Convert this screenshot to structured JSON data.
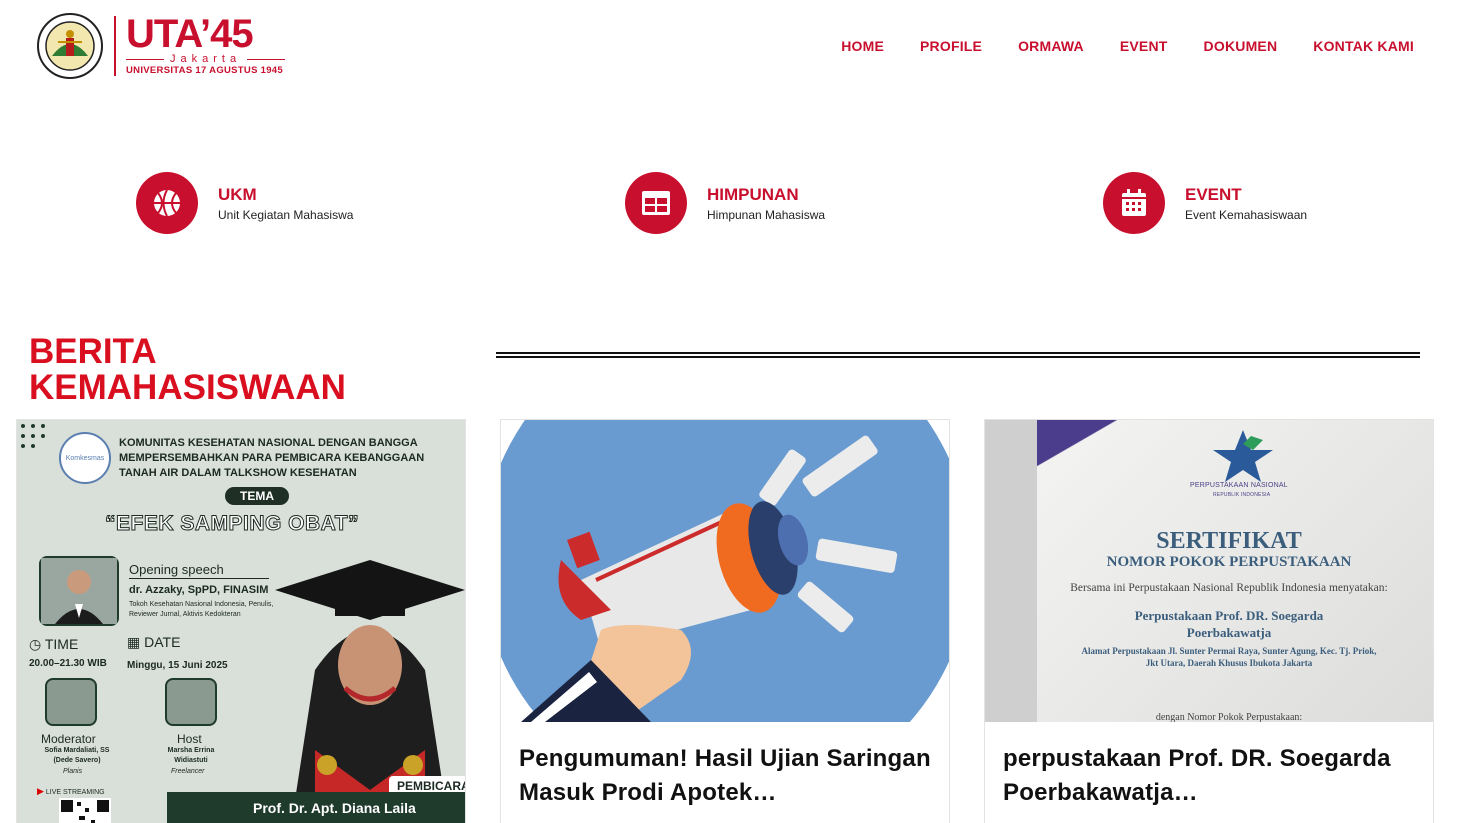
{
  "brand": {
    "main": "UTA’45",
    "city": "Jakarta",
    "university": "UNIVERSITAS 17 AGUSTUS 1945",
    "seal_ring_text": "UNIVERSITAS 17 AGUSTUS 1945 JAKARTA",
    "color": "#c8102e"
  },
  "nav": {
    "items": [
      "HOME",
      "PROFILE",
      "ORMAWA",
      "EVENT",
      "DOKUMEN",
      "KONTAK KAMI"
    ]
  },
  "features": [
    {
      "title": "UKM",
      "subtitle": "Unit Kegiatan Mahasiswa",
      "icon": "basketball-icon"
    },
    {
      "title": "HIMPUNAN",
      "subtitle": "Himpunan Mahasiswa",
      "icon": "table-grid-icon"
    },
    {
      "title": "EVENT",
      "subtitle": "Event Kemahasiswaan",
      "icon": "calendar-icon"
    }
  ],
  "section": {
    "title_line1": "BERITA",
    "title_line2": "KEMAHASISWAAN"
  },
  "cards": [
    {
      "title": "",
      "poster": {
        "org_logo": "Komkesmas",
        "headline": "KOMUNITAS KESEHATAN NASIONAL DENGAN BANGGA MEMPERSEMBAHKAN PARA PEMBICARA KEBANGGAAN TANAH AIR DALAM TALKSHOW KESEHATAN",
        "tema_label": "TEMA",
        "theme": "“EFEK SAMPING OBAT”",
        "opening_label": "Opening speech",
        "opening_name": "dr. Azzaky, SpPD, FINASIM",
        "opening_desc": "Tokoh Kesehatan Nasional Indonesia, Penulis, Reviewer Jurnal, Aktivis Kedokteran",
        "time_label": "TIME",
        "time_value": "20.00–21.30 WIB",
        "date_label": "DATE",
        "date_value": "Minggu, 15 Juni 2025",
        "moderator_label": "Moderator",
        "moderator_name": "Sofia Mardaliati, SS (Dede Savero)",
        "moderator_role": "Planis",
        "host_label": "Host",
        "host_name": "Marsha Errina Widiastuti",
        "host_role": "Freelancer",
        "live_label": "LIVE STREAMING",
        "speaker_tag": "PEMBICARA",
        "speaker_name": "Prof. Dr. Apt. Diana Laila"
      }
    },
    {
      "title": "Pengumuman! Hasil Ujian Saringan Masuk Prodi Apotek…",
      "image": "megaphone-illustration"
    },
    {
      "title": "perpustakaan Prof. DR. Soegarda Poerbakawatja…",
      "cert": {
        "library": "PERPUSTAKAAN NASIONAL",
        "library_sub": "REPUBLIK INDONESIA",
        "heading": "SERTIFIKAT",
        "subheading": "NOMOR POKOK PERPUSTAKAAN",
        "line1": "Bersama ini Perpustakaan Nasional Republik Indonesia menyatakan:",
        "name_line1": "Perpustakaan Prof. DR. Soegarda",
        "name_line2": "Poerbakawatja",
        "address1": "Alamat Perpustakaan  Jl. Sunter Permai Raya, Sunter Agung, Kec. Tj. Priok,",
        "address2": "Jkt Utara, Daerah Khusus Ibukota Jakarta",
        "footer": "dengan Nomor Pokok Perpustakaan:"
      }
    }
  ]
}
